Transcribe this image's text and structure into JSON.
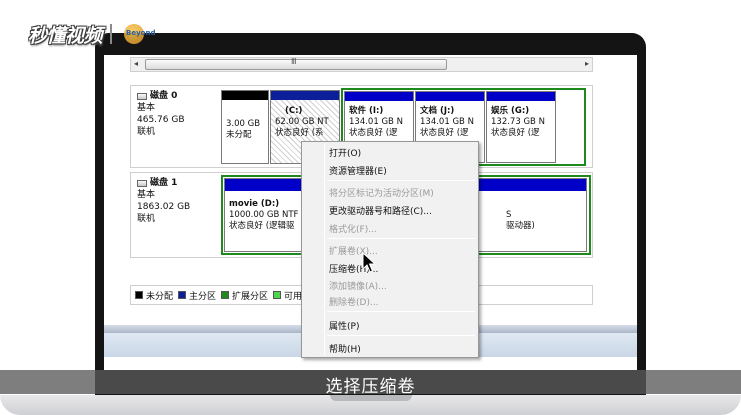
{
  "watermark": {
    "brand": "秒懂视频",
    "logo_text": "Beyond"
  },
  "scrollbar": {
    "left_arrow": "◂",
    "right_arrow": "▸",
    "grip": "Ⅲ"
  },
  "disks": [
    {
      "name": "磁盘 0",
      "type": "基本",
      "size": "465.76 GB",
      "status": "联机",
      "partitions": [
        {
          "size": "3.00 GB",
          "status": "未分配"
        },
        {
          "label": "(C:)",
          "size": "62.00 GB NT",
          "status": "状态良好 (系"
        },
        {
          "label": "软件 (I:)",
          "size": "134.01 GB N",
          "status": "状态良好 (逻"
        },
        {
          "label": "文档 (J:)",
          "size": "134.01 GB N",
          "status": "状态良好 (逻"
        },
        {
          "label": "娱乐 (G:)",
          "size": "132.73 GB N",
          "status": "状态良好 (逻"
        }
      ]
    },
    {
      "name": "磁盘 1",
      "type": "基本",
      "size": "1863.02 GB",
      "status": "联机",
      "partitions": [
        {
          "label": "movie (D:)",
          "size": "1000.00 GB NTF",
          "status": "状态良好 (逻辑驱"
        },
        {
          "size_tail": "S",
          "status_tail": "驱动器)"
        }
      ]
    }
  ],
  "legend": {
    "items": [
      {
        "label": "未分配",
        "color": "#000000"
      },
      {
        "label": "主分区",
        "color": "#0b1f9a"
      },
      {
        "label": "扩展分区",
        "color": "#1e8a1e"
      },
      {
        "label": "可用",
        "color": "#4cd64c"
      }
    ]
  },
  "context_menu": {
    "items": [
      {
        "label": "打开(O)",
        "enabled": true
      },
      {
        "label": "资源管理器(E)",
        "enabled": true
      },
      {
        "label": "将分区标记为活动分区(M)",
        "enabled": false
      },
      {
        "label": "更改驱动器号和路径(C)...",
        "enabled": true
      },
      {
        "label": "格式化(F)...",
        "enabled": false
      },
      {
        "label": "扩展卷(X)...",
        "enabled": false
      },
      {
        "label": "压缩卷(H)...",
        "enabled": true
      },
      {
        "label": "添加镜像(A)...",
        "enabled": false
      },
      {
        "label": "删除卷(D)...",
        "enabled": false
      },
      {
        "label": "属性(P)",
        "enabled": true
      },
      {
        "label": "帮助(H)",
        "enabled": true
      }
    ]
  },
  "subtitle": "选择压缩卷",
  "colors": {
    "unallocated": "#000000",
    "primary": "#0b1f9a",
    "logical": "#0000c8",
    "extended": "#1e8a1e",
    "free": "#4cd64c"
  }
}
